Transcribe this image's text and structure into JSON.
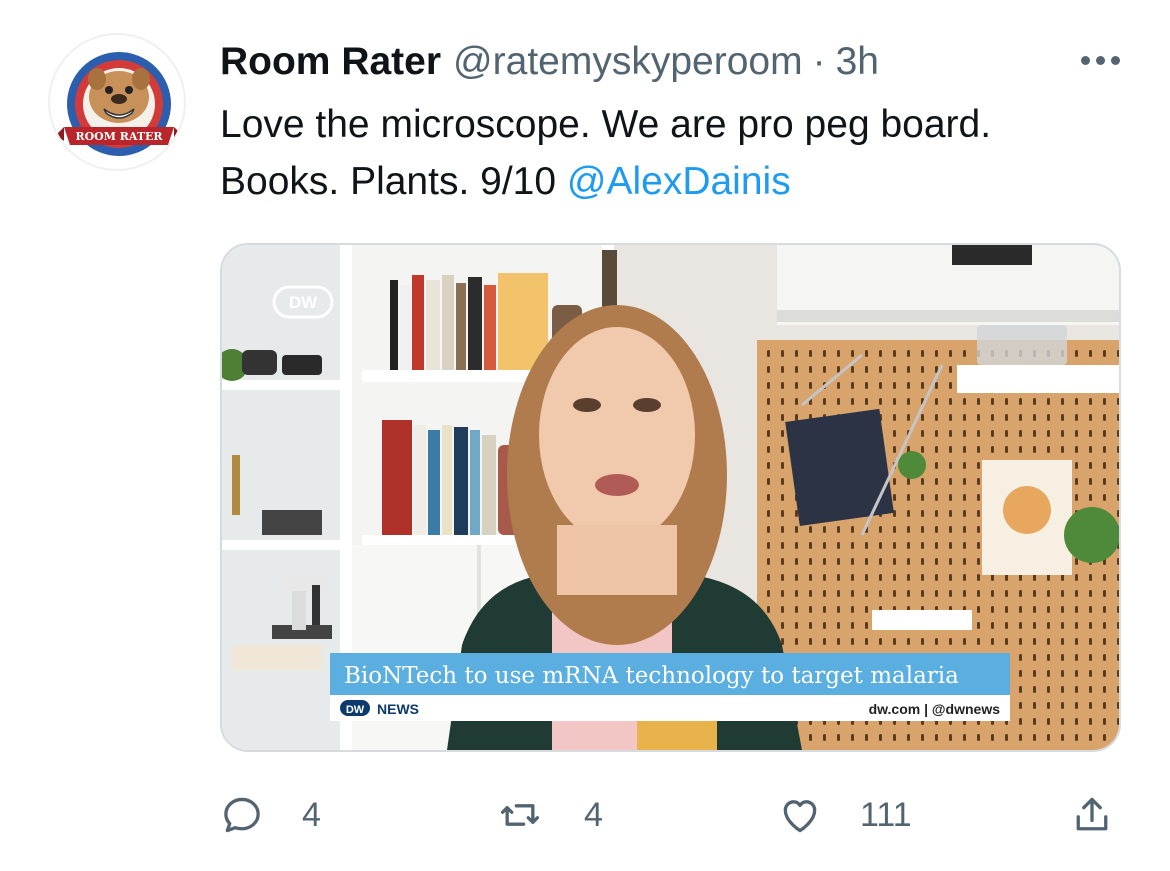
{
  "tweet": {
    "display_name": "Room Rater",
    "handle": "@ratemyskyperoom",
    "separator": "·",
    "time": "3h",
    "text_line1": "Love the microscope. We are pro peg board.",
    "text_line2": "Books. Plants. 9/10 ",
    "mention": "@AlexDainis",
    "avatar_badge_text": "ROOM RATER"
  },
  "media": {
    "channel_logo": "DW",
    "lower_third_headline": "BioNTech to use mRNA technology to target malaria",
    "lower_third_brand": "NEWS",
    "lower_third_links": "dw.com | @dwnews"
  },
  "actions": {
    "reply_count": "4",
    "retweet_count": "4",
    "like_count": "111",
    "icons": [
      "reply-icon",
      "retweet-icon",
      "like-icon",
      "share-icon"
    ]
  },
  "colors": {
    "link": "#1d9bf0",
    "secondary_text": "#536471",
    "lower_third_blue": "#5aaee0",
    "dw_blue": "#0a3b6b"
  }
}
